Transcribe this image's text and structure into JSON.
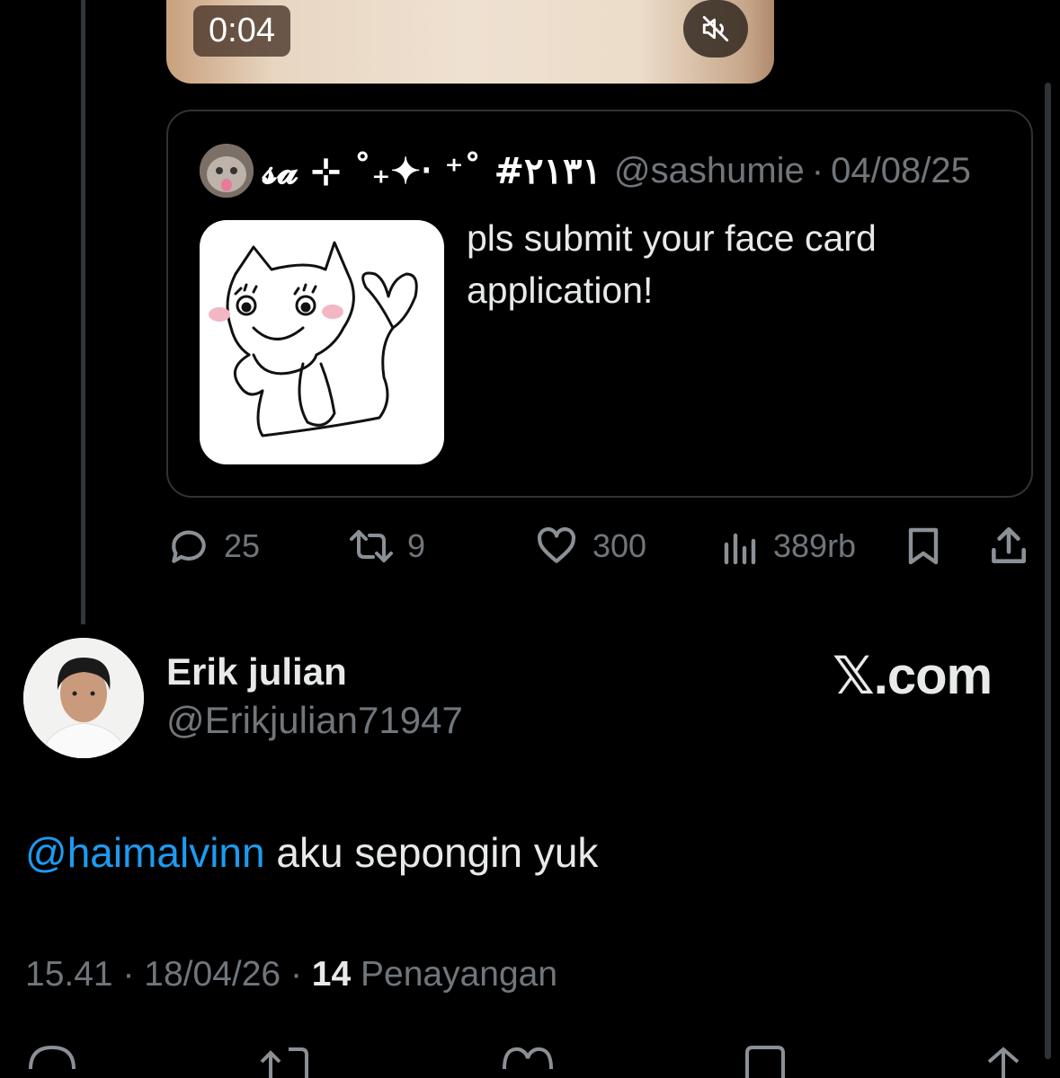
{
  "video": {
    "time": "0:04",
    "mute_icon": "speaker-muted-icon"
  },
  "quoted_tweet": {
    "display_name": "𝓼𝓪 ⊹ ˚₊✦‧ ⁺˚ #٢١٣١",
    "handle": "@sashumie",
    "separator": "·",
    "date": "04/08/25",
    "text": "pls submit your face card application!"
  },
  "actions": {
    "replies": "25",
    "reposts": "9",
    "likes": "300",
    "views": "389rb"
  },
  "reply": {
    "name": "Erik julian",
    "handle": "@Erikjulian71947",
    "brand": "𝕏.com",
    "mention": "@haimalvinn",
    "text": " aku sepongin yuk",
    "time": "15.41",
    "date": "18/04/26",
    "sep": "·",
    "views_count": "14",
    "views_label": "Penayangan"
  },
  "colors": {
    "background": "#000000",
    "accent": "#1d9bf0",
    "muted": "#71767b"
  }
}
